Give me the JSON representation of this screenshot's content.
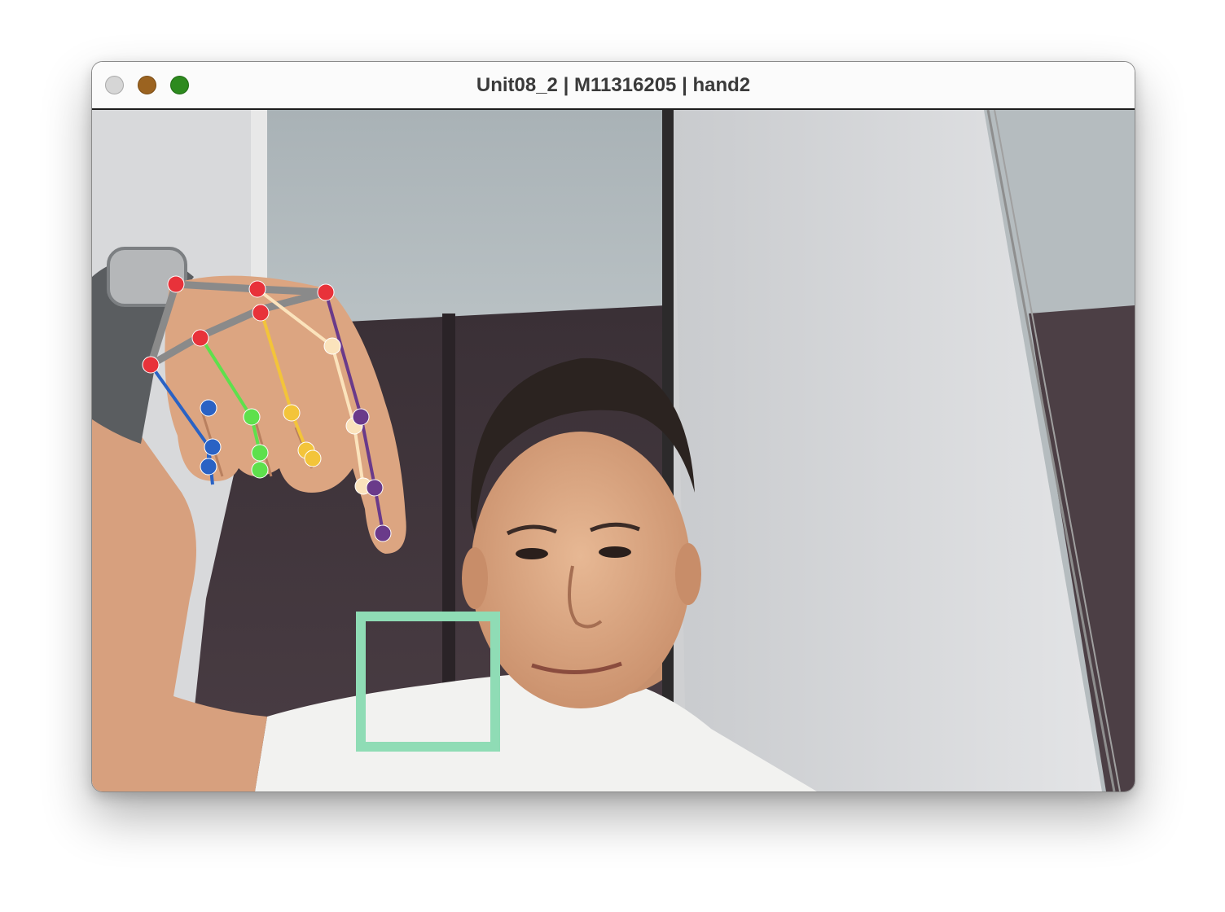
{
  "window": {
    "title": "Unit08_2 | M11316205 | hand2",
    "traffic_lights": [
      "close",
      "minimize",
      "maximize"
    ]
  },
  "camera_view": {
    "content": "webcam frame with hand landmark overlay",
    "target_box_color": "#8fdcb5"
  },
  "hand_overlay": {
    "colors": {
      "palm": "#8a8a8a",
      "palm_joint": "#e8323a",
      "thumb": "#2a62c4",
      "index": "#5ee04c",
      "middle": "#f3c43a",
      "ring": "#fbe3bc",
      "pinky": "#6a3a8a"
    }
  }
}
